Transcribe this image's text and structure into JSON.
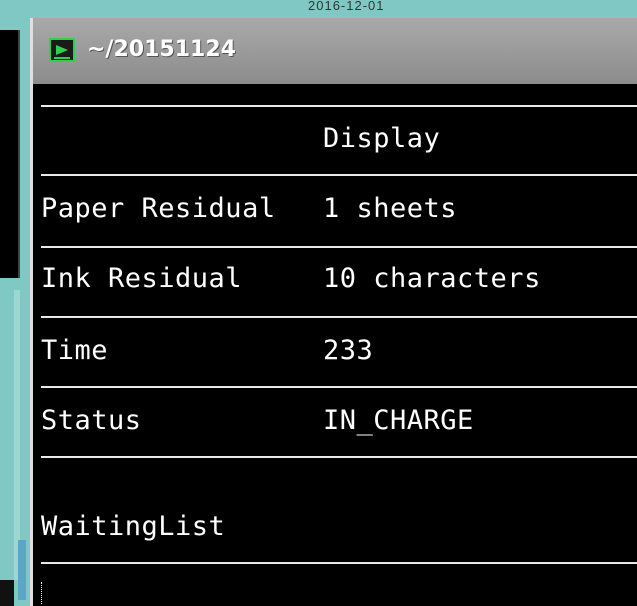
{
  "background": {
    "label": "2016-12-01"
  },
  "window": {
    "title": "~/20151124",
    "icon": "terminal-icon"
  },
  "table": {
    "header_value": "Display",
    "rows": [
      {
        "label": "Paper Residual",
        "value": "1 sheets"
      },
      {
        "label": "Ink Residual",
        "value": "10 characters"
      },
      {
        "label": "Time",
        "value": "233"
      },
      {
        "label": "Status",
        "value": "IN_CHARGE"
      }
    ],
    "waiting_label": "WaitingList"
  },
  "colors": {
    "desktop": "#7fc8c4",
    "terminal_bg": "#000000",
    "text": "#ffffff",
    "titlebar": "#9a9a9a",
    "icon_green": "#2fd04a"
  }
}
